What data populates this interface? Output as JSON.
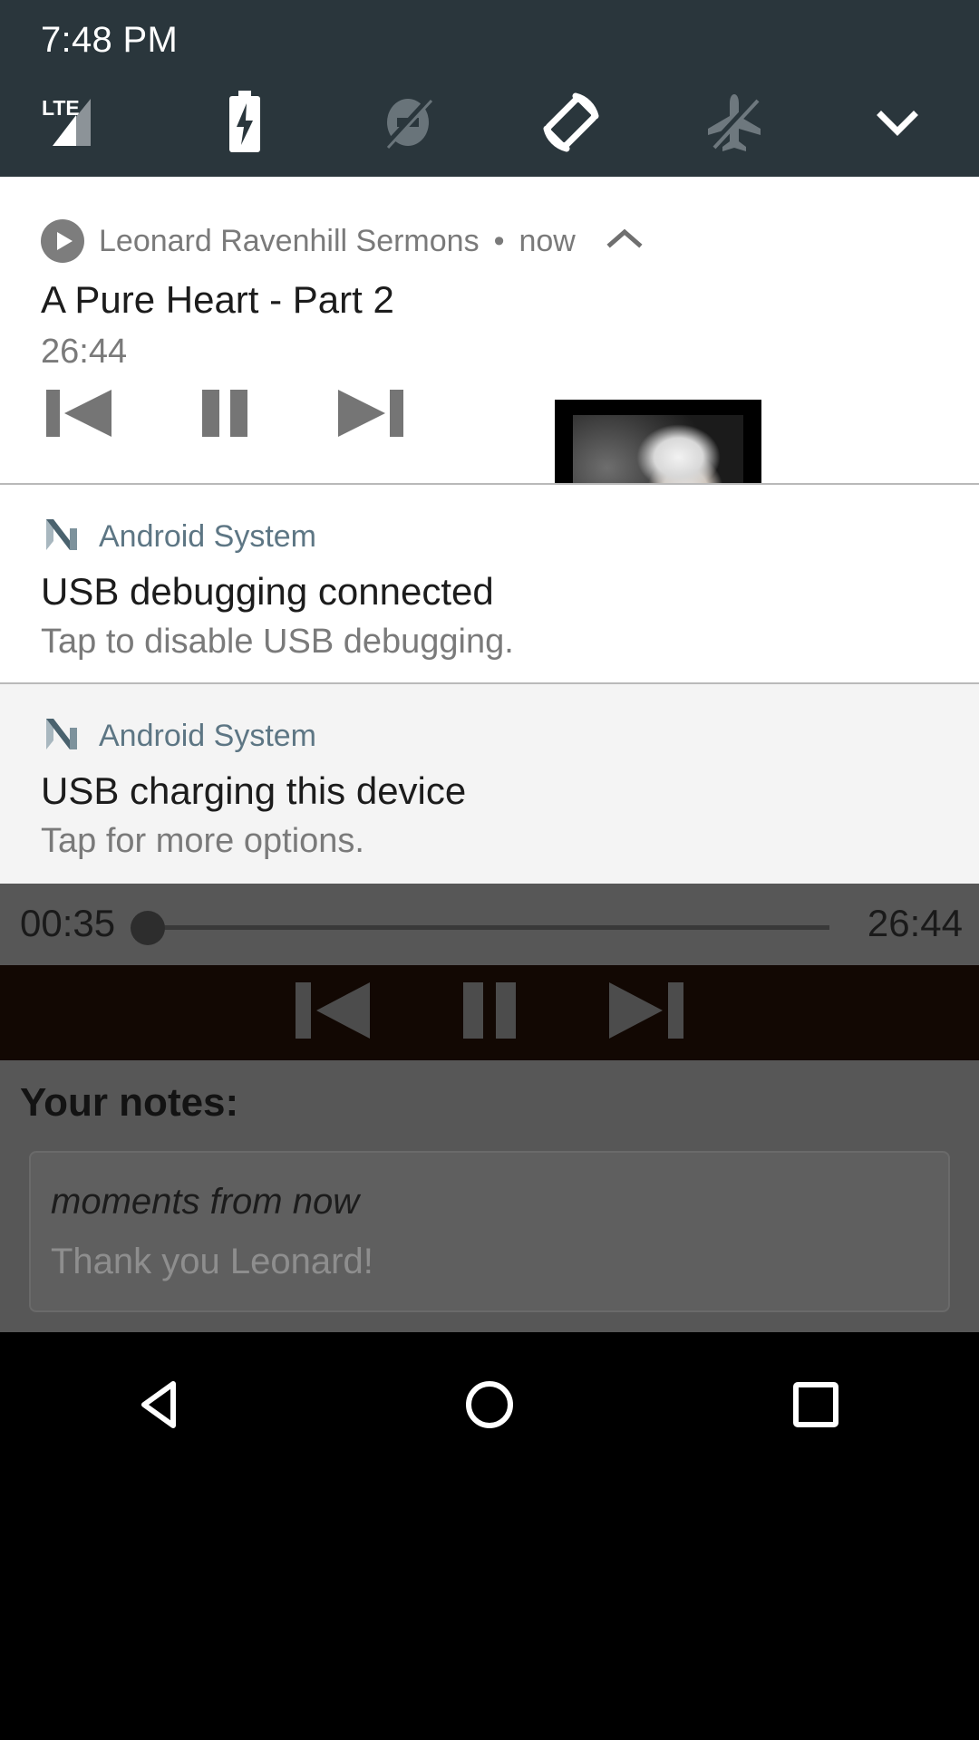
{
  "statusbar": {
    "clock": "7:48 PM",
    "background_color": "#2a363c",
    "icons": [
      {
        "name": "lte-signal-icon",
        "label": "LTE"
      },
      {
        "name": "battery-charging-icon",
        "label": ""
      },
      {
        "name": "notifications-off-icon",
        "label": ""
      },
      {
        "name": "auto-rotate-icon",
        "label": ""
      },
      {
        "name": "airplane-mode-off-icon",
        "label": ""
      },
      {
        "name": "chevron-down-icon",
        "label": ""
      }
    ]
  },
  "notifications": [
    {
      "type": "media",
      "app_name": "Leonard Ravenhill Sermons",
      "separator": "•",
      "time": "now",
      "collapse_icon": "chevron-up-icon",
      "title": "A Pure Heart - Part 2",
      "duration": "26:44",
      "app_icon": "play-circle-icon",
      "album_art_alt": "portrait of an elderly man with glasses",
      "controls": [
        {
          "name": "previous-button",
          "icon": "skip-previous-icon"
        },
        {
          "name": "pause-button",
          "icon": "pause-icon"
        },
        {
          "name": "next-button",
          "icon": "skip-next-icon"
        }
      ]
    },
    {
      "type": "system",
      "app_name": "Android System",
      "app_icon": "android-nougat-icon",
      "title": "USB debugging connected",
      "body": "Tap to disable USB debugging."
    },
    {
      "type": "system",
      "app_name": "Android System",
      "app_icon": "android-nougat-icon",
      "title": "USB charging this device",
      "body": "Tap for more options."
    }
  ],
  "app_behind": {
    "seek": {
      "current_time": "00:35",
      "total_time": "26:44",
      "progress_percent": 2
    },
    "controls": [
      {
        "name": "previous-button",
        "icon": "skip-previous-icon"
      },
      {
        "name": "pause-button",
        "icon": "pause-icon"
      },
      {
        "name": "next-button",
        "icon": "skip-next-icon"
      }
    ],
    "notes": {
      "label": "Your notes:",
      "placeholder": "moments from now",
      "value": "Thank you Leonard!"
    }
  },
  "navbar": {
    "buttons": [
      {
        "name": "nav-back-button",
        "icon": "back-triangle-icon"
      },
      {
        "name": "nav-home-button",
        "icon": "home-circle-icon"
      },
      {
        "name": "nav-recents-button",
        "icon": "recents-square-icon"
      }
    ]
  }
}
